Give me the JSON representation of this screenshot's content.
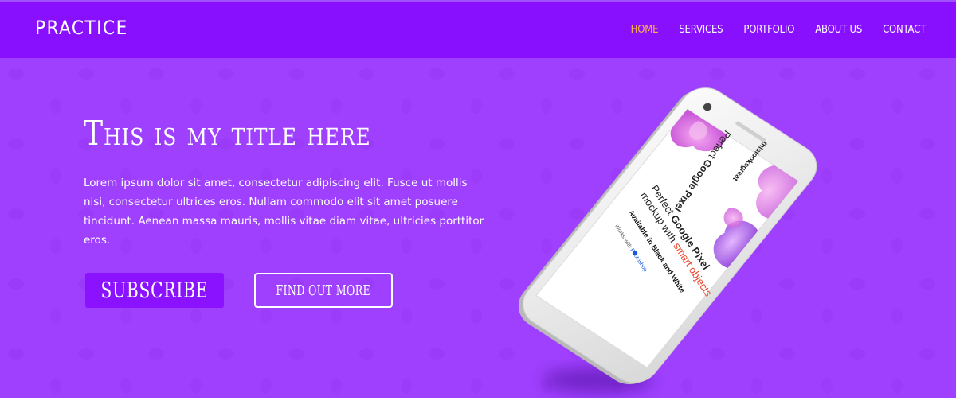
{
  "brand": "PRACTICE",
  "nav": {
    "items": [
      {
        "label": "HOME",
        "active": true
      },
      {
        "label": "SERVICES",
        "active": false
      },
      {
        "label": "PORTFOLIO",
        "active": false
      },
      {
        "label": "ABOUT US",
        "active": false
      },
      {
        "label": "CONTACT",
        "active": false
      }
    ]
  },
  "hero": {
    "title": "This is my title here",
    "paragraph": "Lorem ipsum dolor sit amet, consectetur adipiscing elit. Fusce ut mollis nisi, consectetur ultrices eros. Nullam commodo elit sit amet posuere tincidunt. Aenean massa mauris, mollis vitae diam vitae, ultricies porttitor eros.",
    "subscribe_label": "SUBSCRIBE",
    "find_out_label": "FIND OUT MORE"
  },
  "phone_screen": {
    "logo": "thislooksgreat",
    "line1_a": "Perfect ",
    "line1_b": "Google Pixel",
    "line2_a": "mockup with ",
    "line2_b": "smart objects",
    "availability": "Available in Black and White",
    "works_with": "Works with",
    "app": "Photoshop"
  },
  "colors": {
    "header_bg": "#8810ff",
    "hero_bg": "#9f40ff",
    "nav_active": "#ffb347",
    "subscribe_bg": "#8a12ff",
    "accent_red": "#e8442a"
  }
}
